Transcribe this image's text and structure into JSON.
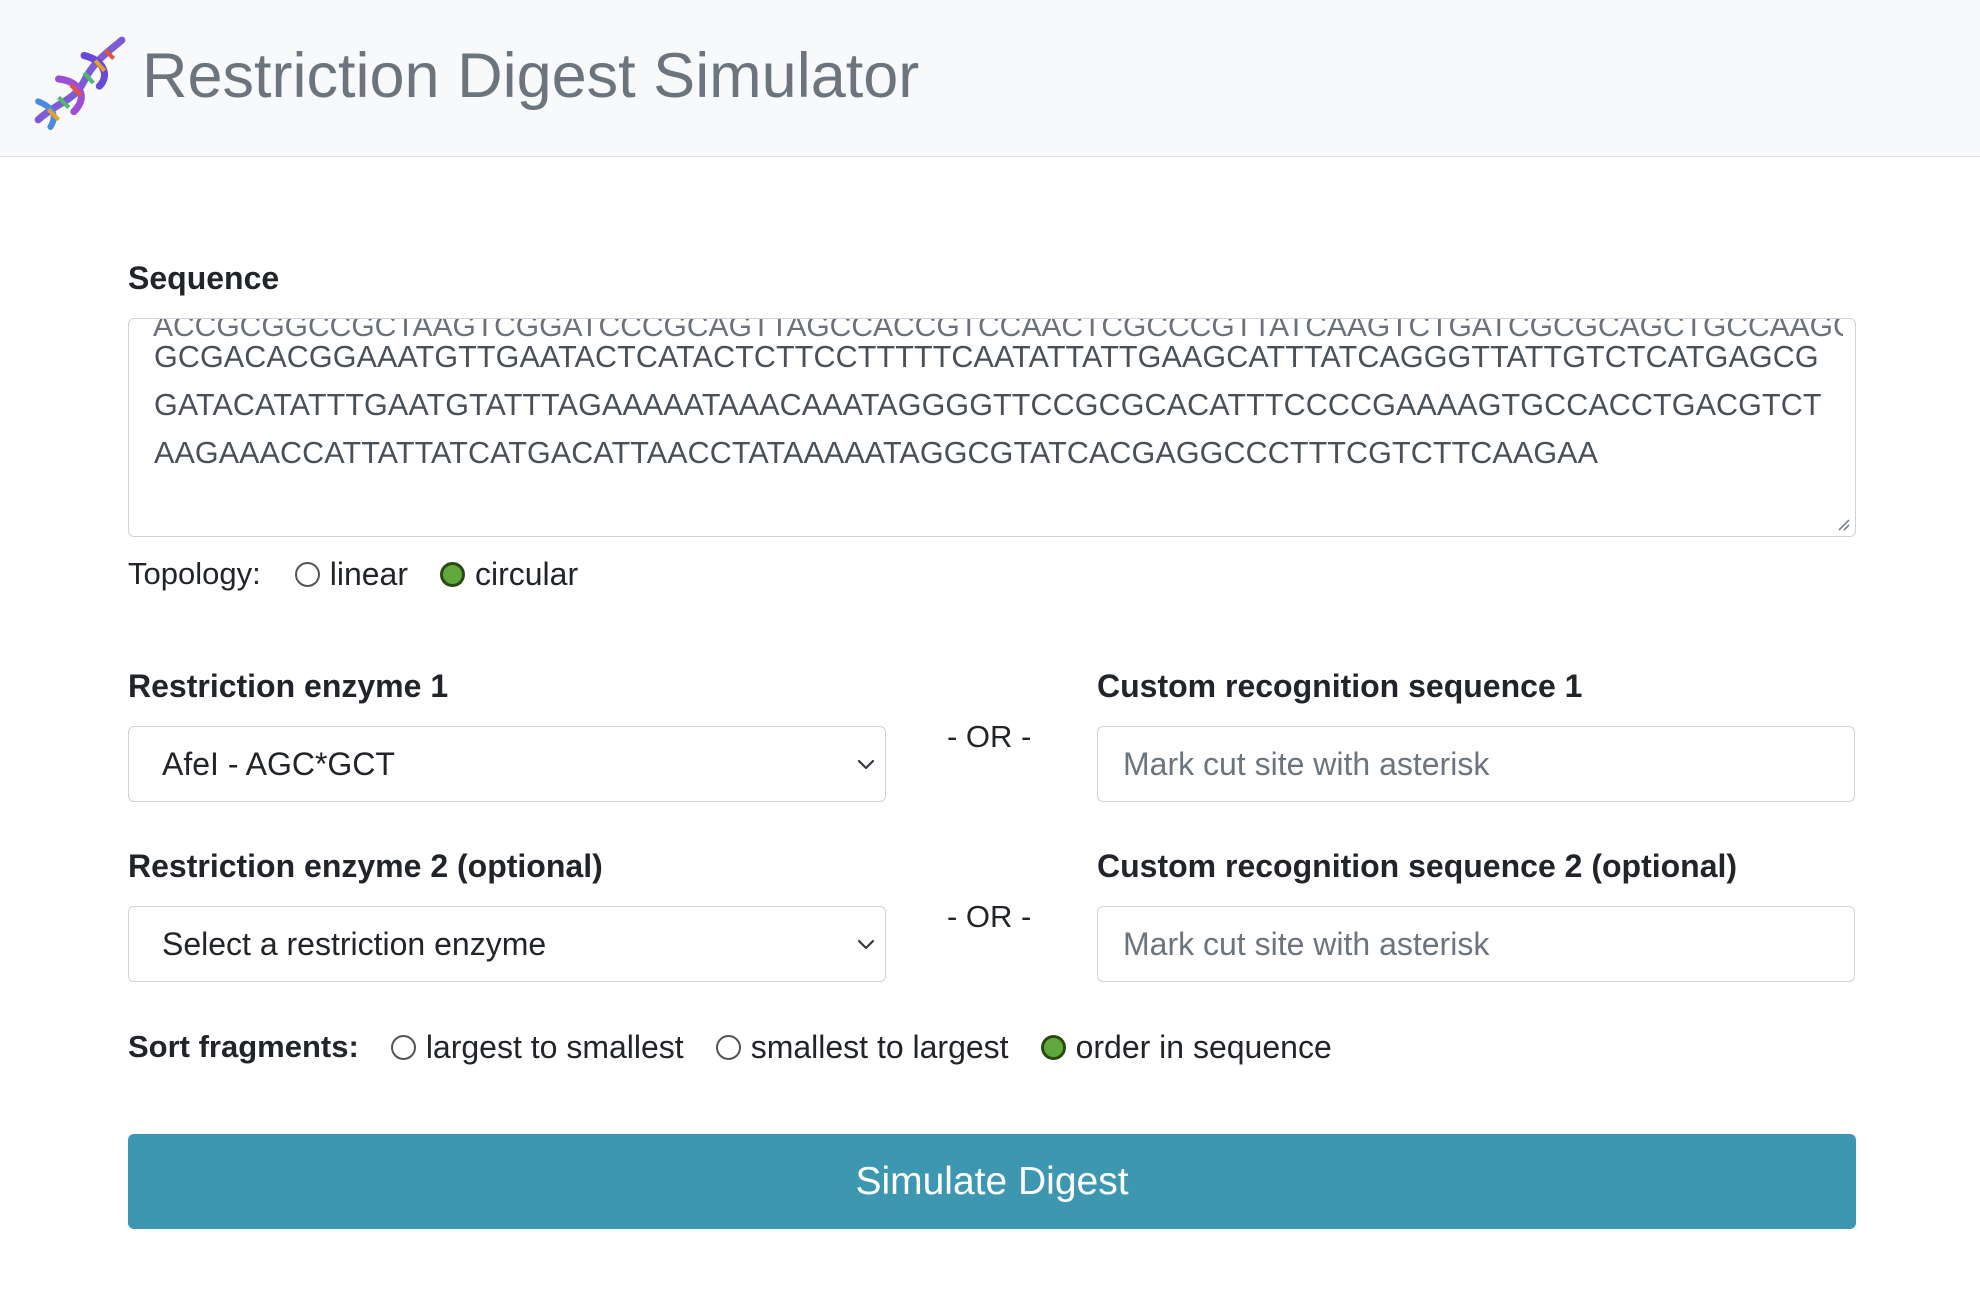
{
  "header": {
    "logo_icon": "dna-helix-icon",
    "title": "Restriction Digest Simulator",
    "background": "#f8f9fa",
    "title_color": "#6c757d"
  },
  "sequence": {
    "label": "Sequence",
    "lines": [
      "GCGACACGGAAATGTTGAATACTCATACTCTTCCTTTTTCAATATTATTGAAGCATTTATCAGGGTTATTGTCTCATGAGCG",
      "GATACATATTTGAATGTATTTAGAAAAATAAACAAATAGGGGTTCCGCGCACATTTCCCCGAAAAGTGCCACCTGACGTCT",
      "AAGAAACCATTATTATCATGACATTAACCTATAAAAATAGGCGTATCACGAGGCCCTTTCGTCTTCAAGAA"
    ],
    "scrolled_line_fragment": "ACCGCGGCCGCTAAGTCGGATCCCGCAGTTAGCCACCGTCCAACTCGCCCGTTATCAAGTCTGATCGCGCAGCTGCCAAGCGG"
  },
  "topology": {
    "label": "Topology:",
    "options": [
      {
        "label": "linear",
        "checked": false
      },
      {
        "label": "circular",
        "checked": true
      }
    ]
  },
  "enzyme1": {
    "label": "Restriction enzyme 1",
    "selected": "AfeI - AGC*GCT",
    "or_label": "- OR -",
    "custom_label": "Custom recognition sequence 1",
    "custom_placeholder": "Mark cut site with asterisk"
  },
  "enzyme2": {
    "label": "Restriction enzyme 2 (optional)",
    "selected": "Select a restriction enzyme",
    "or_label": "- OR -",
    "custom_label": "Custom recognition sequence 2 (optional)",
    "custom_placeholder": "Mark cut site with asterisk"
  },
  "sort": {
    "label": "Sort fragments:",
    "options": [
      {
        "label": "largest to smallest",
        "checked": false
      },
      {
        "label": "smallest to largest",
        "checked": false
      },
      {
        "label": "order in sequence",
        "checked": true
      }
    ]
  },
  "submit": {
    "label": "Simulate Digest",
    "color": "#3e97b1"
  },
  "colors": {
    "radio_checked": "#5fa83c",
    "border": "#ced4da",
    "placeholder": "#6c757d"
  }
}
